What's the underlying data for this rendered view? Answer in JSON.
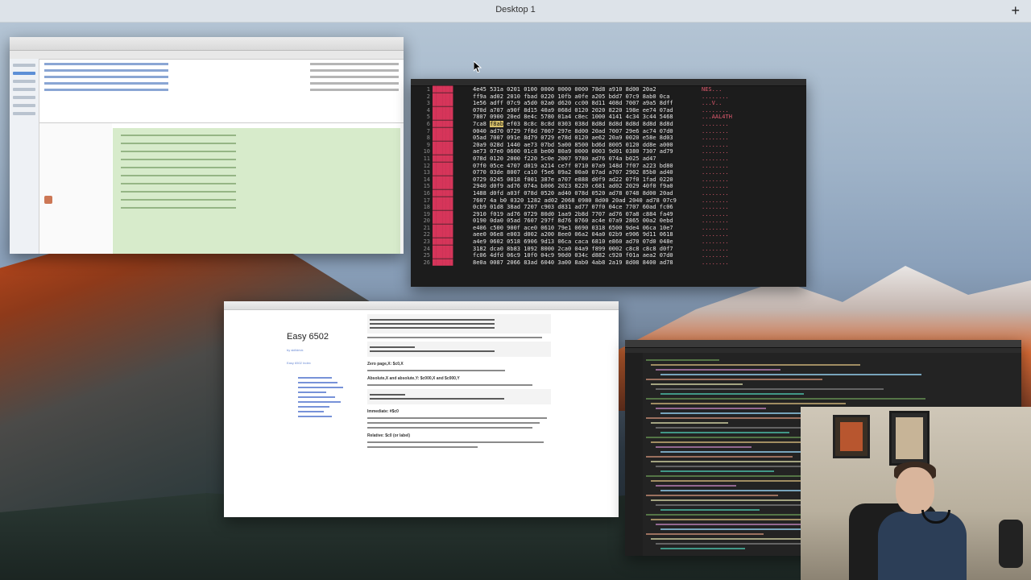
{
  "topbar": {
    "desktop_label": "Desktop 1",
    "add_space_label": "+"
  },
  "hex_editor": {
    "rows": [
      {
        "ln": "1",
        "hex": "4e45 531a 0201 0100 0000 0000 0000 78d8 a910 8d00 20a2",
        "ascii": "NES..."
      },
      {
        "ln": "2",
        "hex": "ff9a ad02 2010 fbad 0220 10fb a0fe a205 bdd7 07c9 8ab0 0ca",
        "ascii": "........"
      },
      {
        "ln": "3",
        "hex": "1e56 adff 07c9 a5d0 02a0 d620 cc00 8d11 408d 7007 a9a5 8dff",
        "ascii": "...V.."
      },
      {
        "ln": "4",
        "hex": "070d a707 a90f 8d15 40a9 068d 0120 2020 8220 198e ee74 07ad",
        "ascii": "........"
      },
      {
        "ln": "5",
        "hex": "7807 0900 20ed 8e4c 5780 01a4 c8ec 1000 4141 4c34 3c44 5468",
        "ascii": "...AAL4TH"
      },
      {
        "ln": "6",
        "hex": "7ca8 f8ab ef03 8c8c 8c8d 0303 038d 8d8d 8d8d 8d8d 8d8d 8d8d",
        "ascii": "........"
      },
      {
        "ln": "7",
        "hex": "0040 ad70 0729 7f8d 7007 297e 8d00 20ad 7007 29e6 ac74 07d0",
        "ascii": "........"
      },
      {
        "ln": "8",
        "hex": "05ad 7007 091e 8d79 0729 e78d 0120 ae62 20a9 0020 e58e 8d03",
        "ascii": "........"
      },
      {
        "ln": "9",
        "hex": "20a9 028d 1440 ae73 07bd 5a00 8500 bd6d 8005 0120 dd8e a000",
        "ascii": "........"
      },
      {
        "ln": "10",
        "hex": "ae73 07e0 0600 01c8 be00 80a9 0000 0003 9d01 0380 7307 ad79",
        "ascii": "........"
      },
      {
        "ln": "11",
        "hex": "078d 0120 2000 f220 5c0e 2007 9780 ad76 074a b025 ad47",
        "ascii": "........"
      },
      {
        "ln": "12",
        "hex": "07f0 05ce 4707 d019 a214 ce7f 0710 07a9 148d 7f07 a223 bd80",
        "ascii": "........"
      },
      {
        "ln": "13",
        "hex": "0770 03de 8007 ca10 f5e6 09a2 00a0 07ad a707 2902 85b0 ad40",
        "ascii": "........"
      },
      {
        "ln": "14",
        "hex": "0729 0245 0018 f001 387e a707 e888 d0f9 ad22 07f0 1fad 0220",
        "ascii": "........"
      },
      {
        "ln": "15",
        "hex": "2940 d0f9 ad76 074a b006 2023 8220 c681 ad02 2029 40f0 f9a0",
        "ascii": "........"
      },
      {
        "ln": "16",
        "hex": "1488 d0fd a03f 078d 0520 ad40 078d 0520 ad78 0748 8d00 20ad",
        "ascii": "........"
      },
      {
        "ln": "17",
        "hex": "7607 4a b0 0320 1282 ad02 2068 0980 8d00 20ad 2040 ad78 07c9",
        "ascii": "........"
      },
      {
        "ln": "18",
        "hex": "0cb9 01d8 38ad 7207 c903 d831 ad77 07f0 04ce 7707 60ad fc06",
        "ascii": "........"
      },
      {
        "ln": "19",
        "hex": "2910 f019 ad76 0729 80d0 1aa9 2b8d 7707 ad76 07a8 c884 fa49",
        "ascii": "........"
      },
      {
        "ln": "20",
        "hex": "0190 0da0 05ad 7607 297f 8d76 0760 ac4e 07a9 2865 00a2 0ebd",
        "ascii": "........"
      },
      {
        "ln": "21",
        "hex": "e406 c500 900f ace0 0610 79e1 0690 0318 6500 9de4 06ca 10e7",
        "ascii": "........"
      },
      {
        "ln": "22",
        "hex": "aee0 06e8 e003 d002 a200 8ee0 06a2 04a0 02b9 e906 9d11 0618",
        "ascii": "........"
      },
      {
        "ln": "23",
        "hex": "a4e9 0602 0518 6906 9d13 06ca caca 6810 e860 ad70 07d0 048e",
        "ascii": "........"
      },
      {
        "ln": "24",
        "hex": "3182 dca0 8b83 1092 8000 2ca0 04a9 f899 0002 c8c8 c8c8 d0f7",
        "ascii": "........"
      },
      {
        "ln": "25",
        "hex": "fc06 4dfd 06c9 10f0 04c9 90d0 034c d882 c920 f01a aea2 07d0",
        "ascii": "........"
      },
      {
        "ln": "26",
        "hex": "8e0a 0087 2066 83ad 6040 3a00 8ab0 4ab8 2a19 8d08 8400 ad78",
        "ascii": "........"
      }
    ]
  },
  "doc": {
    "title": "Easy 6502",
    "link1": "by skilldrick",
    "link2": "Easy 6502 Index",
    "headings": [
      "Zero page,X: $c0,X",
      "Absolute,X and absolute,Y: $c000,X and $c000,Y",
      "Immediate: #$c0",
      "Relative: $c0 (or label)"
    ]
  },
  "windows": {
    "mail_title": "",
    "editor_title": ""
  }
}
